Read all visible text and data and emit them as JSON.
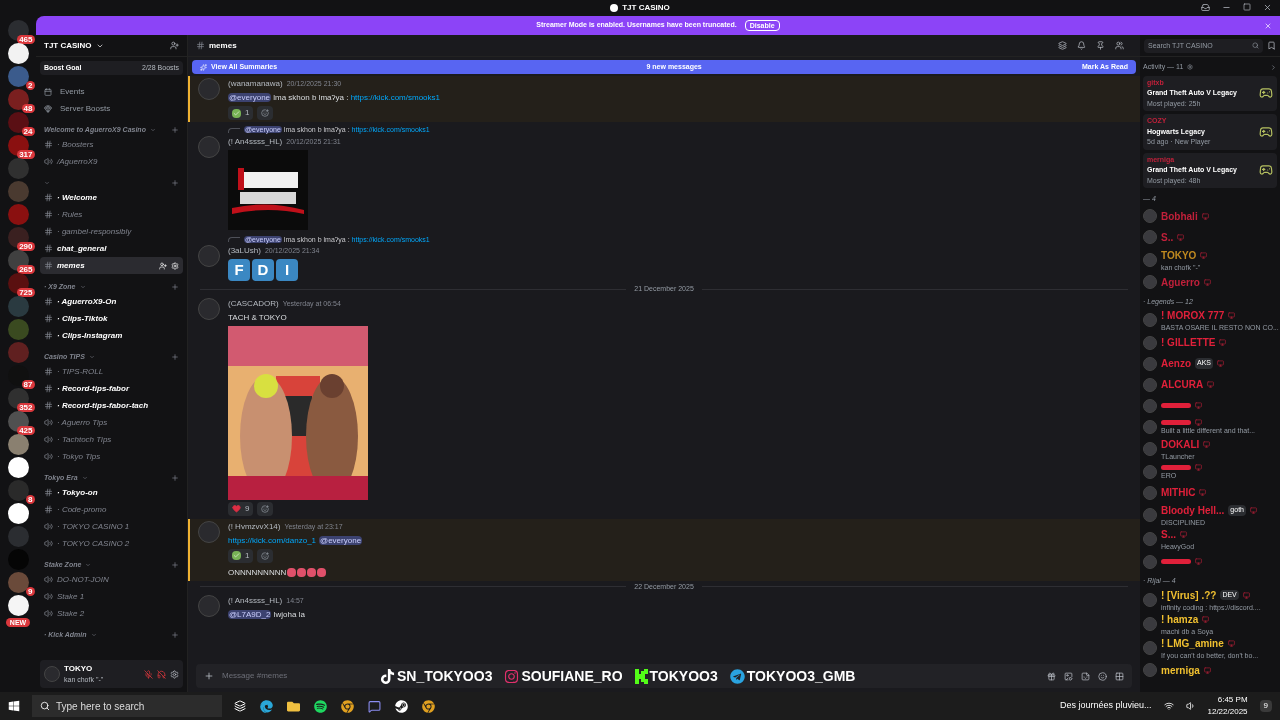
{
  "window": {
    "title": "TJT CASINO"
  },
  "streamer_banner": {
    "text": "Streamer Mode is enabled. Usernames have been truncated.",
    "button": "Disable"
  },
  "servers": [
    {
      "badge": "465",
      "color": "#2b2d31"
    },
    {
      "color": "#f2f2f2"
    },
    {
      "badge": "2",
      "color": "#3b5b8c"
    },
    {
      "badge": "48",
      "color": "#7a1f1f"
    },
    {
      "badge": "24",
      "color": "#5a0f14"
    },
    {
      "badge": "317",
      "color": "#8a1010"
    },
    {
      "color": "#303030"
    },
    {
      "color": "#4a3a30"
    },
    {
      "color": "#8a1010"
    },
    {
      "badge": "290",
      "color": "#3a2020"
    },
    {
      "badge": "265",
      "color": "#404040"
    },
    {
      "badge": "725",
      "color": "#5a1010"
    },
    {
      "color": "#2a3a40"
    },
    {
      "color": "#3a4a20"
    },
    {
      "color": "#602020"
    },
    {
      "badge": "87",
      "color": "#101010"
    },
    {
      "badge": "352",
      "color": "#303030"
    },
    {
      "badge": "425",
      "color": "#505050"
    },
    {
      "color": "#8a8070"
    },
    {
      "color": "#ffffff"
    },
    {
      "badge": "8",
      "color": "#2a2a2a"
    },
    {
      "color": "#ffffff"
    },
    {
      "color": "#2b2d31"
    },
    {
      "color": "#050505"
    },
    {
      "badge": "9",
      "color": "#6a4a3a"
    },
    {
      "color": "#f5f5f5"
    }
  ],
  "new_badge": "NEW",
  "server": {
    "name": "TJT CASINO",
    "boost_goal": "Boost Goal",
    "boost_count": "2/28 Boosts",
    "nav": [
      "Events",
      "Server Boosts"
    ]
  },
  "categories": [
    {
      "name": "Welcome to AguerroX9 Casino",
      "channels": [
        {
          "kind": "text",
          "name": "· Boosters",
          "unread": false,
          "selected": false
        },
        {
          "kind": "voice",
          "name": "/AguerroX9",
          "unread": false,
          "selected": false
        }
      ]
    },
    {
      "channels": [
        {
          "kind": "text",
          "name": "· Welcome",
          "unread": true,
          "selected": false
        },
        {
          "kind": "text",
          "name": "· Rules",
          "unread": false,
          "selected": false
        },
        {
          "kind": "text",
          "name": "· gambel-responsibly",
          "unread": false,
          "selected": false
        },
        {
          "kind": "text",
          "name": "chat_general",
          "unread": true,
          "selected": false
        },
        {
          "kind": "text",
          "name": "memes",
          "unread": true,
          "selected": true
        }
      ]
    },
    {
      "name": "· X9 Zone",
      "channels": [
        {
          "kind": "text",
          "name": "· AguerroX9-On",
          "unread": true,
          "selected": false
        },
        {
          "kind": "text",
          "name": "· Clips-Tiktok",
          "unread": true,
          "selected": false
        },
        {
          "kind": "text",
          "name": "· Clips-Instagram",
          "unread": true,
          "selected": false
        }
      ]
    },
    {
      "name": "Casino TIPS",
      "channels": [
        {
          "kind": "text",
          "name": "· TIPS-ROLL",
          "unread": false,
          "selected": false
        },
        {
          "kind": "text",
          "name": "· Record-tips-fabor",
          "unread": true,
          "selected": false
        },
        {
          "kind": "text",
          "name": "· Record-tips-fabor-tach",
          "unread": true,
          "selected": false
        },
        {
          "kind": "voice",
          "name": "· Aguerro Tips",
          "unread": false,
          "selected": false
        },
        {
          "kind": "voice",
          "name": "· Tachtoch Tips",
          "unread": false,
          "selected": false
        },
        {
          "kind": "voice",
          "name": "· Tokyo Tips",
          "unread": false,
          "selected": false
        }
      ]
    },
    {
      "name": "Tokyo Era",
      "channels": [
        {
          "kind": "text",
          "name": "· Tokyo-on",
          "unread": true,
          "selected": false
        },
        {
          "kind": "text",
          "name": "· Code-promo",
          "unread": false,
          "selected": false
        },
        {
          "kind": "voice",
          "name": "· TOKYO CASINO 1",
          "unread": false,
          "selected": false
        },
        {
          "kind": "voice",
          "name": "· TOKYO CASINO 2",
          "unread": false,
          "selected": false
        }
      ]
    },
    {
      "name": "Stake Zone",
      "channels": [
        {
          "kind": "voice",
          "name": "DO-NOT-JOIN",
          "unread": false,
          "selected": false
        },
        {
          "kind": "voice",
          "name": "Stake 1",
          "unread": false,
          "selected": false
        },
        {
          "kind": "voice",
          "name": "Stake 2",
          "unread": false,
          "selected": false
        }
      ]
    },
    {
      "name": "· Kick Admin"
    }
  ],
  "user_panel": {
    "name": "TOKYO",
    "status": "kan chofk \"-\""
  },
  "channel_header": {
    "name": "memes",
    "search_placeholder": "Search TJT CASINO"
  },
  "summary_bar": {
    "label": "View All Summaries",
    "new_messages": "9 new messages",
    "mark_read": "Mark As Read"
  },
  "messages": [
    {
      "author": "(wanamanawa)",
      "time": "20/12/2025 21:30",
      "mentioned": true,
      "parts": [
        {
          "kind": "mention",
          "text": "@everyone"
        },
        {
          "kind": "text",
          "text": " lma skhon b lmaʔya : "
        },
        {
          "kind": "link",
          "text": "https://kick.com/smooks1"
        }
      ],
      "reactions": [
        {
          "kind": "check",
          "count": "1"
        }
      ]
    },
    {
      "author": "(!      An4ssss_HL)",
      "time": "20/12/2025 21:31",
      "mentioned": false,
      "reply": [
        {
          "kind": "mention",
          "text": "@everyone"
        },
        {
          "kind": "text",
          "text": " lma skhon b lmaʔya : "
        },
        {
          "kind": "link",
          "text": "https://kick.com/smooks1"
        }
      ],
      "image": {
        "kind": "picture"
      }
    },
    {
      "author": "(3aLUsh)",
      "time": "20/12/2025 21:34",
      "mentioned": false,
      "reply": [
        {
          "kind": "mention",
          "text": "@everyone"
        },
        {
          "kind": "text",
          "text": " lma skhon b lmaʔya : "
        },
        {
          "kind": "link",
          "text": "https://kick.com/smooks1"
        }
      ],
      "letters": [
        "F",
        "D",
        "I"
      ]
    },
    {
      "kind": "divider",
      "text": "21 December 2025"
    },
    {
      "author": "(CASCADOR)",
      "time": "Yesterday at 06:54",
      "mentioned": false,
      "parts": [
        {
          "kind": "text",
          "text": "TACH & TOKYO"
        }
      ],
      "image": {
        "kind": "picture"
      },
      "reactions": [
        {
          "kind": "heart",
          "count": "9"
        }
      ]
    },
    {
      "author": "(!      HvmzvvX14)",
      "time": "Yesterday at 23:17",
      "mentioned": true,
      "parts": [
        {
          "kind": "link",
          "text": "https://kick.com/danzo_1"
        },
        {
          "kind": "mention",
          "text": "@everyone"
        }
      ],
      "reactions": [
        {
          "kind": "check",
          "count": "1"
        }
      ],
      "followup": "ONNNNNNNNN"
    },
    {
      "kind": "divider",
      "text": "22 December 2025"
    },
    {
      "author": "(!      An4ssss_HL)",
      "time": "14:57",
      "mentioned": false,
      "parts": [
        {
          "kind": "mention",
          "text": "@L7A9D_2"
        },
        {
          "kind": "text",
          "text": " lwjoha la"
        }
      ]
    }
  ],
  "composer": {
    "placeholder": "Message #memes"
  },
  "stream_overlay": [
    {
      "kind": "tiktok",
      "text": "SN_TOKYOO3"
    },
    {
      "kind": "instagram",
      "text": "SOUFIANE_RO"
    },
    {
      "kind": "kick",
      "text": "TOKYOO3"
    },
    {
      "kind": "telegram",
      "text": "TOKYOO3_GMB"
    }
  ],
  "activity": {
    "title": "Activity — 11",
    "items": [
      {
        "user": "gitxb",
        "game": "Grand Theft Auto V Legacy",
        "detail": "Most played: 25h"
      },
      {
        "user": "COZY",
        "game": "Hogwarts Legacy",
        "detail": "5d ago · New Player"
      },
      {
        "user": "merniga",
        "game": "Grand Theft Auto V Legacy",
        "detail": "Most played: 48h"
      }
    ]
  },
  "member_groups": [
    {
      "title": "— 4",
      "members": [
        {
          "name": "Bobhali",
          "color": "#c0203a"
        },
        {
          "name": "S..",
          "color": "#c0203a"
        },
        {
          "name": "TOKYO",
          "color": "#c08a20",
          "status": "kan chofk \"-\""
        },
        {
          "name": "Aguerro",
          "color": "#c0203a"
        }
      ]
    },
    {
      "title": "· Legends — 12",
      "members": [
        {
          "name": "! MOROX 777",
          "color": "#e0203a",
          "status": "BASTA OSARE IL RESTO NON CO..."
        },
        {
          "name": "! GILLETTE",
          "color": "#e0203a"
        },
        {
          "name": "Aenzo",
          "color": "#e0203a",
          "tag": "AKS"
        },
        {
          "name": "ALCURA",
          "color": "#e0203a"
        },
        {
          "color": "#e0203a"
        },
        {
          "color": "#e0203a",
          "status": "Built a little different and that..."
        },
        {
          "name": "DOKALI",
          "color": "#e0203a",
          "status": "TLauncher"
        },
        {
          "color": "#e0203a",
          "status": "ERO"
        },
        {
          "name": "MITHIC",
          "color": "#e0203a"
        },
        {
          "name": "Bloody Hell...",
          "color": "#e0203a",
          "tag": "goth",
          "status": "DISCIPLINED"
        },
        {
          "name": "S...",
          "color": "#e0203a",
          "status": "HeavyGod"
        },
        {
          "color": "#e0203a"
        }
      ]
    },
    {
      "title": "· Rijal — 4",
      "members": [
        {
          "name": "! [Virus] .??",
          "color": "#f0c030",
          "tag": "DEV",
          "status": "infinity coding : https://discord...."
        },
        {
          "name": "! hamza",
          "color": "#f0c030",
          "status": "machi db a Soya"
        },
        {
          "name": "! LMG_amine",
          "color": "#f0c030",
          "status": "If you can't do better, don't bo..."
        },
        {
          "name": "merniga",
          "color": "#f0c030"
        }
      ]
    }
  ],
  "taskbar": {
    "search_placeholder": "Type here to search",
    "weather": "Des journées pluvieu...",
    "time": "6:45 PM",
    "date": "12/22/2025",
    "notifications": "9"
  }
}
